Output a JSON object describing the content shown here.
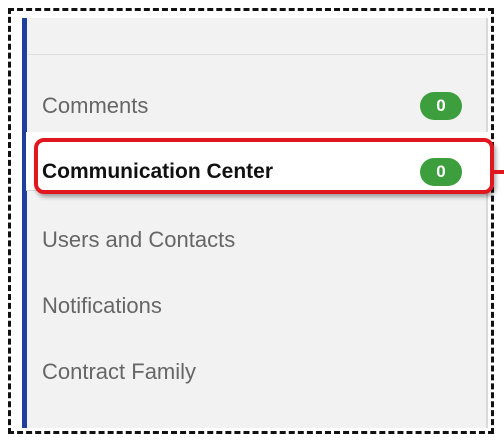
{
  "nav": {
    "items": [
      {
        "label": "Comments",
        "badge": "0"
      },
      {
        "label": "Communication Center",
        "badge": "0",
        "active": true
      },
      {
        "label": "Users and Contacts"
      },
      {
        "label": "Notifications"
      },
      {
        "label": "Contract Family"
      }
    ]
  },
  "colors": {
    "accent": "#1f3f9c",
    "badge": "#3d9e3d",
    "highlight": "#e0171f"
  }
}
